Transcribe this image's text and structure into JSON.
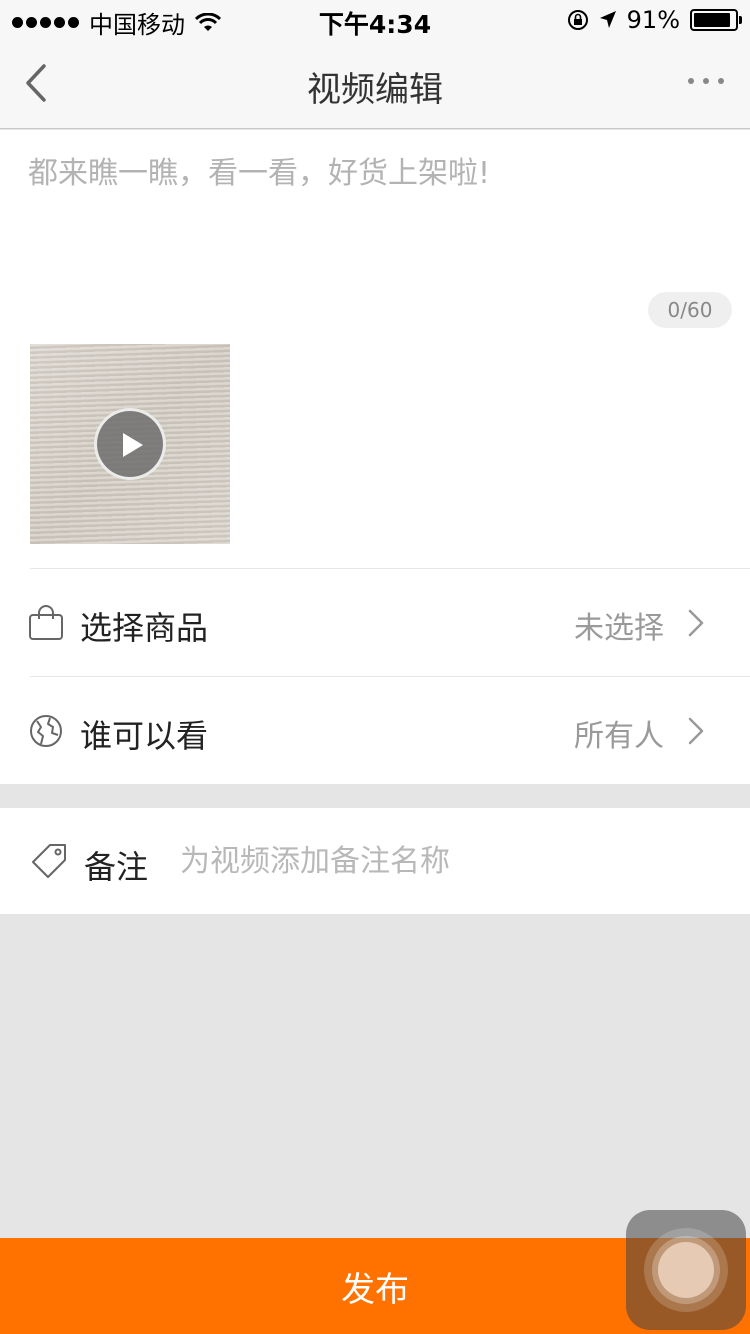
{
  "status_bar": {
    "carrier": "中国移动",
    "time": "下午4:34",
    "battery": "91%"
  },
  "nav": {
    "title": "视频编辑"
  },
  "description": {
    "placeholder": "都来瞧一瞧，看一看，好货上架啦!",
    "char_count": "0/60"
  },
  "options": [
    {
      "label": "选择商品",
      "value": "未选择",
      "icon": "shopping-bag-icon"
    },
    {
      "label": "谁可以看",
      "value": "所有人",
      "icon": "globe-icon"
    }
  ],
  "note": {
    "label": "备注",
    "placeholder": "为视频添加备注名称",
    "icon": "tag-icon"
  },
  "publish": {
    "label": "发布"
  },
  "colors": {
    "accent": "#ff7200",
    "background": "#e5e5e5"
  }
}
